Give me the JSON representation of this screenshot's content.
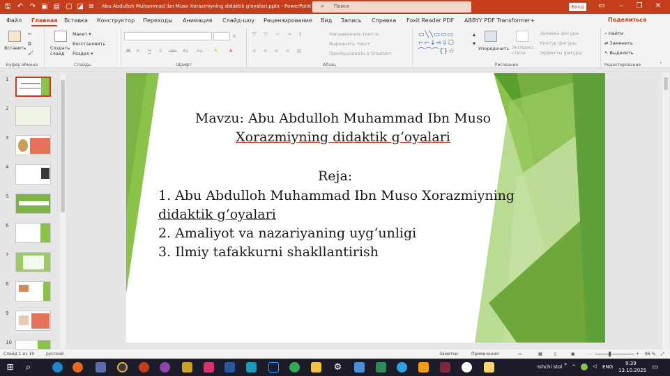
{
  "window": {
    "document_title": "Abu Abdulloh Muhammad Ibn Muso Xorazmiyning didaktik g'oyalari.pptx - PowerPoint",
    "search_placeholder": "Поиск",
    "login_label": "Вход",
    "accent_color": "#c43e1c"
  },
  "tabs": [
    "Файл",
    "Главная",
    "Вставка",
    "Конструктор",
    "Переходы",
    "Анимация",
    "Слайд-шоу",
    "Рецензирование",
    "Вид",
    "Запись",
    "Справка",
    "Foxit Reader PDF",
    "ABBYY PDF Transformer+"
  ],
  "active_tab": "Главная",
  "share_label": "Поделиться",
  "ribbon": {
    "clipboard": {
      "paste": "Вставить",
      "group": "Буфер обмена"
    },
    "slides": {
      "new_slide": "Создать слайд",
      "layout": "Макет",
      "reset": "Восстановить",
      "section": "Раздел",
      "group": "Слайды"
    },
    "font": {
      "group": "Шрифт"
    },
    "paragraph": {
      "text_direction": "Направление текста",
      "align_text": "Выровнять текст",
      "smartart": "Преобразовать в SmartArt",
      "group": "Абзац"
    },
    "drawing": {
      "arrange": "Упорядочить",
      "quick_styles": "Экспресс-стили",
      "shape_fill": "Заливка фигуры",
      "shape_outline": "Контур фигуры",
      "shape_effects": "Эффекты фигуры",
      "group": "Рисование"
    },
    "editing": {
      "find": "Найти",
      "replace": "Заменить",
      "select": "Выделить",
      "group": "Редактирование"
    }
  },
  "thumbnails": [
    "1",
    "2",
    "3",
    "4",
    "5",
    "6",
    "7",
    "8",
    "9",
    "10"
  ],
  "slide": {
    "title_line1": "Mavzu: Abu Abdulloh Muhammad Ibn Muso",
    "title_line2": "Xorazmiyning didaktik g‘oyalari",
    "plan_heading": "Reja:",
    "item1_line1": "1. Abu Abdulloh Muhammad Ibn Muso Xorazmiyning",
    "item1_line2": "didaktik g‘oyalari",
    "item2": "2. Amaliyot va nazariyaning uyg‘unligi",
    "item3": "3. Ilmiy tafakkurni shakllantirish"
  },
  "status": {
    "slide_counter": "Слайд 1 из 19",
    "language": "русский",
    "notes": "Заметки",
    "comments": "Примечания",
    "zoom": "86 %"
  },
  "taskbar": {
    "desktop_label": "Ishchi stol",
    "lang": "ENG",
    "time": "9:39",
    "date": "13.10.2025"
  }
}
